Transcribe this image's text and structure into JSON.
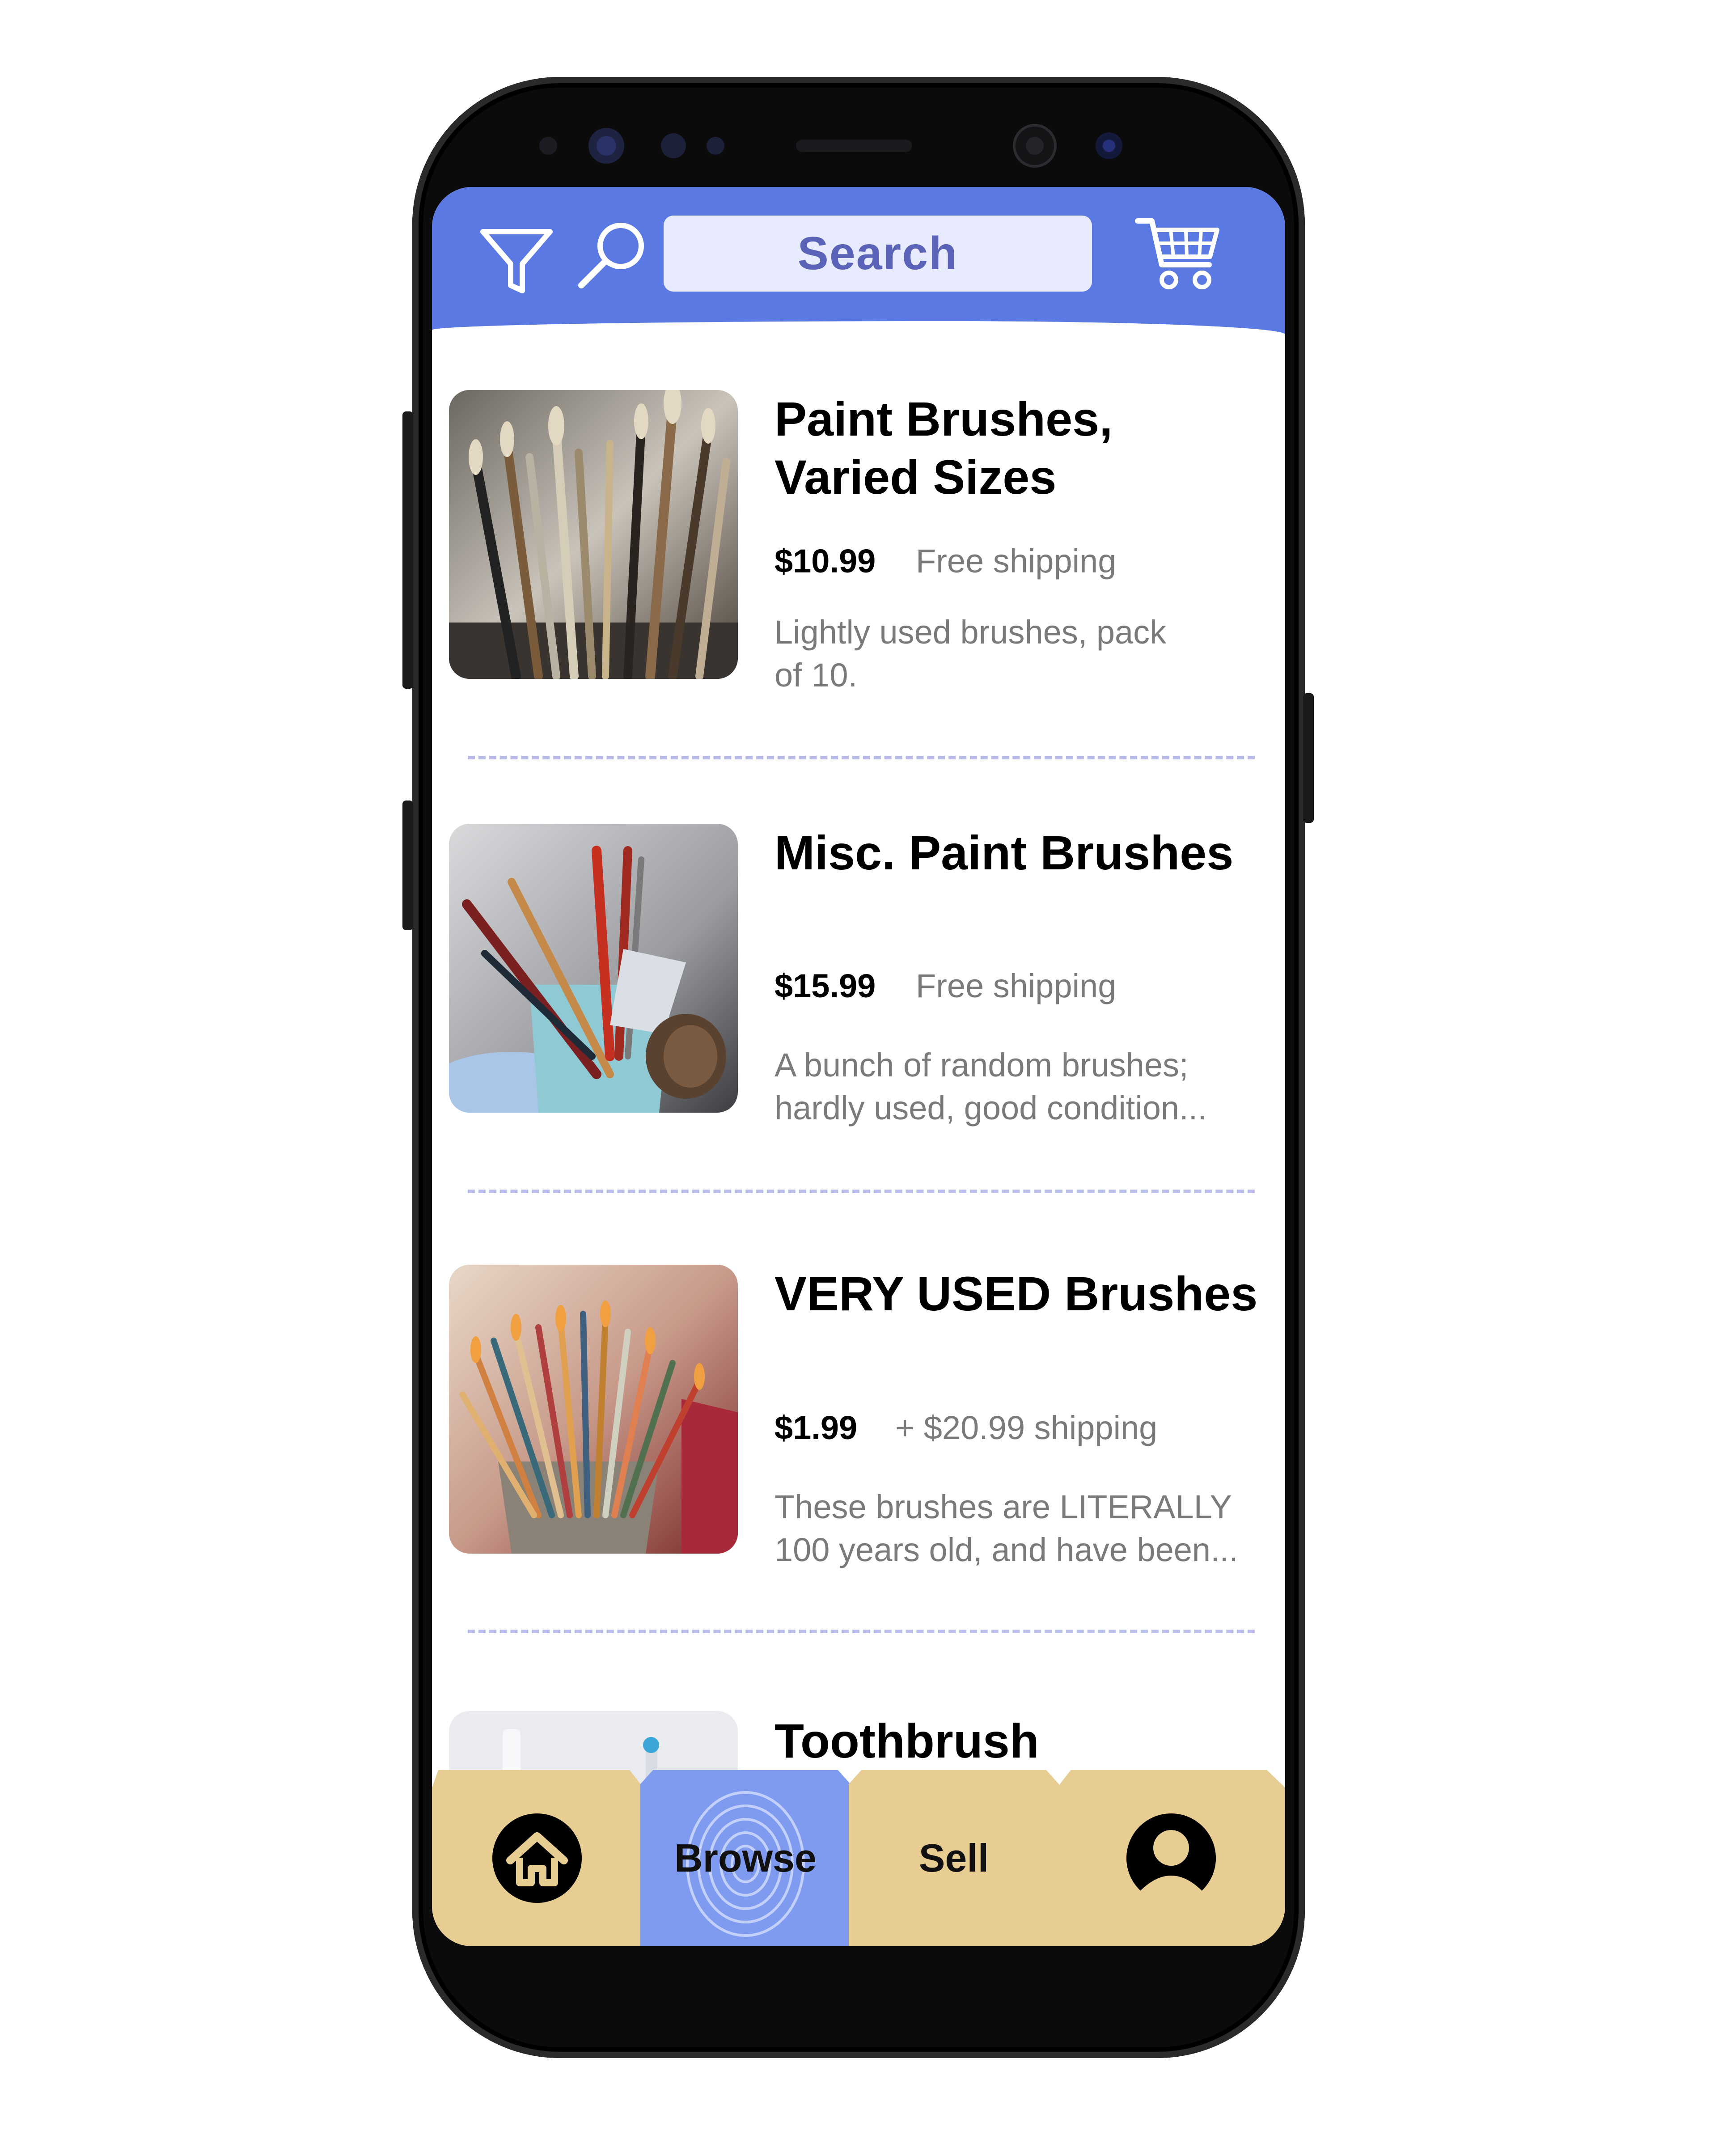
{
  "colors": {
    "accent": "#5b79e2",
    "search_bg": "#e7ebfd",
    "search_text": "#5a63b8",
    "tab_bg": "#e8cd92",
    "tab_active": "#7f9bf0",
    "muted_text": "#7a7a7a",
    "divider": "#b9bde8"
  },
  "header": {
    "filter_icon": "filter-icon",
    "search_icon": "magnifier-icon",
    "search_label": "Search",
    "cart_icon": "shopping-cart-icon"
  },
  "listings": [
    {
      "title_line1": "Paint Brushes,",
      "title_line2": "Varied Sizes",
      "price": "$10.99",
      "shipping": "Free shipping",
      "desc_line1": "Lightly used brushes, pack",
      "desc_line2": "of 10."
    },
    {
      "title_line1": "Misc. Paint Brushes",
      "title_line2": "",
      "price": "$15.99",
      "shipping": "Free shipping",
      "desc_line1": "A bunch of random brushes;",
      "desc_line2": "hardly used, good condition..."
    },
    {
      "title_line1": "VERY USED Brushes",
      "title_line2": "",
      "price": "$1.99",
      "shipping": "+ $20.99 shipping",
      "desc_line1": "These brushes are LITERALLY",
      "desc_line2": "100 years old, and have been..."
    },
    {
      "title_line1": "Toothbrush",
      "title_line2": ""
    }
  ],
  "nav": {
    "home_icon": "home-icon",
    "browse_label": "Browse",
    "sell_label": "Sell",
    "profile_icon": "user-icon",
    "active": "Browse"
  }
}
